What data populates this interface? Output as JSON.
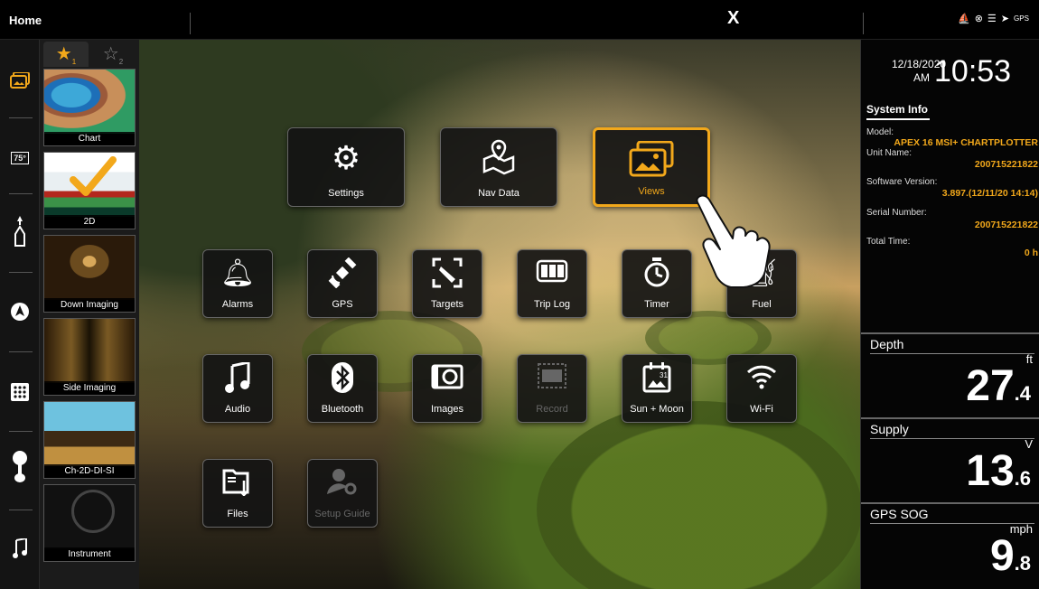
{
  "topbar": {
    "title": "Home",
    "close_label": "X",
    "gps_label": "GPS"
  },
  "favorites": {
    "tab1": "★",
    "tab1_num": "1",
    "tab2": "☆",
    "tab2_num": "2",
    "items": [
      {
        "label": "Chart"
      },
      {
        "label": "2D"
      },
      {
        "label": "Down Imaging"
      },
      {
        "label": "Side Imaging"
      },
      {
        "label": "Ch-2D-DI-SI"
      },
      {
        "label": "Instrument"
      }
    ]
  },
  "rail": {
    "temp_label": "75°"
  },
  "apps": {
    "settings": "Settings",
    "nav_data": "Nav Data",
    "views": "Views",
    "alarms": "Alarms",
    "gps": "GPS",
    "targets": "Targets",
    "trip_log": "Trip Log",
    "timer": "Timer",
    "fuel": "Fuel",
    "audio": "Audio",
    "bluetooth": "Bluetooth",
    "images": "Images",
    "record": "Record",
    "sun_moon": "Sun + Moon",
    "wifi": "Wi-Fi",
    "files": "Files",
    "setup_guide": "Setup Guide"
  },
  "datetime": {
    "date": "12/18/2020",
    "ampm": "AM",
    "time": "10:53"
  },
  "system_info": {
    "title": "System Info",
    "model_label": "Model:",
    "model": "APEX 16 MSI+ CHARTPLOTTER",
    "unit_name_label": "Unit Name:",
    "unit_name": "200715221822",
    "software_label": "Software Version:",
    "software": "3.897.(12/11/20 14:14)",
    "serial_label": "Serial Number:",
    "serial": "200715221822",
    "total_time_label": "Total Time:",
    "total_time": "0 h"
  },
  "gauges": {
    "depth": {
      "title": "Depth",
      "unit": "ft",
      "int": "27",
      "dec": ".4"
    },
    "supply": {
      "title": "Supply",
      "unit": "V",
      "int": "13",
      "dec": ".6"
    },
    "sog": {
      "title": "GPS SOG",
      "unit": "mph",
      "int": "9",
      "dec": ".8"
    }
  },
  "colors": {
    "accent": "#f2a81b",
    "tile_bg": "#141414"
  }
}
